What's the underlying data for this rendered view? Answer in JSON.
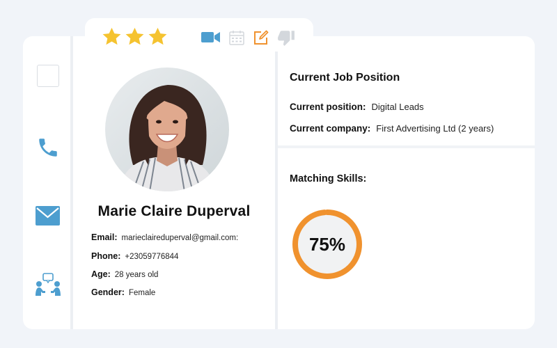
{
  "toolbar": {
    "rating": 3,
    "rating_max": 3,
    "star_color": "#f5c330",
    "icons": [
      "video-icon",
      "calendar-icon",
      "edit-icon",
      "thumbs-down-icon"
    ]
  },
  "sidebar": {
    "icons": [
      "checkbox-icon",
      "phone-icon",
      "mail-icon",
      "team-icon"
    ],
    "icon_color": "#4d9ecf"
  },
  "profile": {
    "name": "Marie Claire Duperval",
    "email_label": "Email:",
    "email": "marieclaireduperval@gmail.com:",
    "phone_label": "Phone:",
    "phone": "+23059776844",
    "age_label": "Age:",
    "age": "28 years old",
    "gender_label": "Gender:",
    "gender": "Female"
  },
  "job": {
    "title": "Current Job Position",
    "position_label": "Current position:",
    "position": "Digital Leads",
    "company_label": "Current company:",
    "company": "First Advertising Ltd (2 years)"
  },
  "skills": {
    "title": "Matching Skills:",
    "percent_label": "75%",
    "percent": 0.75,
    "ring_color": "#f0922e"
  }
}
